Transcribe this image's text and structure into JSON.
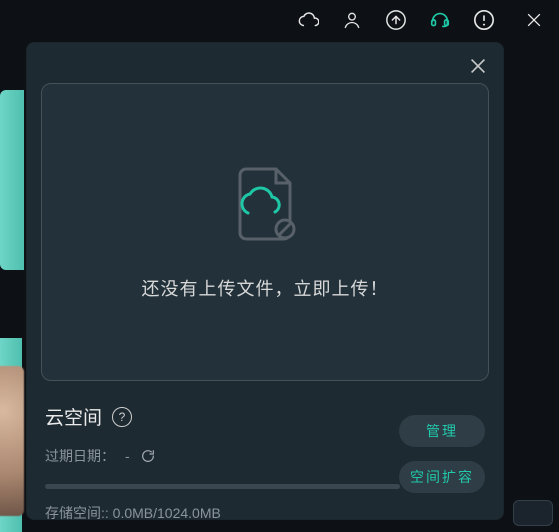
{
  "topbar": {
    "icons": [
      "cloud-icon",
      "user-icon",
      "upload-icon",
      "headset-icon",
      "info-icon",
      "app-close-icon"
    ]
  },
  "dialog": {
    "empty_prompt": "还没有上传文件，立即上传！",
    "section_title": "云空间",
    "expiry_label": "过期日期：",
    "expiry_value": "-",
    "storage_label": "存储空间::",
    "storage_value": "0.0MB/1024.0MB",
    "manage_label": "管理",
    "expand_label": "空间扩容"
  }
}
